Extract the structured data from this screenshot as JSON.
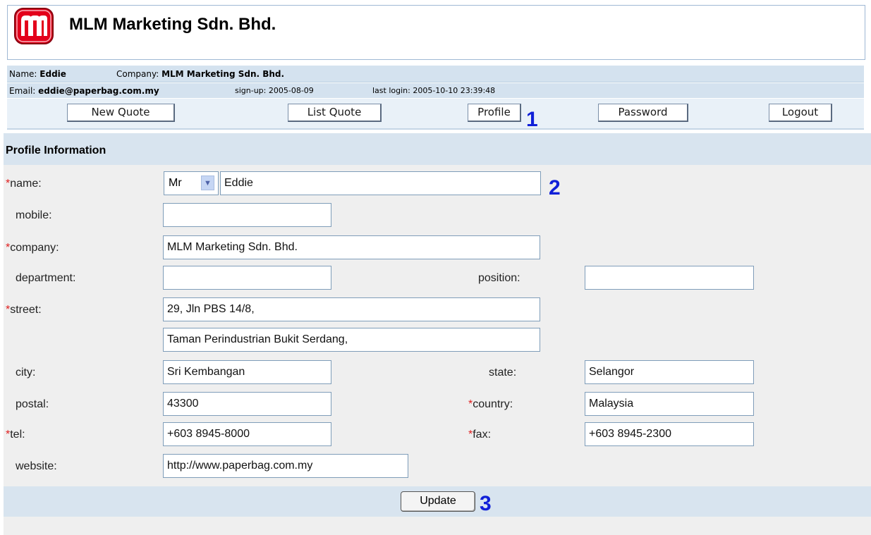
{
  "header": {
    "title": "MLM Marketing Sdn. Bhd."
  },
  "account": {
    "name_label": "Name:",
    "name": "Eddie",
    "company_label": "Company:",
    "company": "MLM Marketing Sdn. Bhd.",
    "email_label": "Email:",
    "email": "eddie@paperbag.com.my",
    "signup": "sign-up: 2005-08-09",
    "last_login": "last login: 2005-10-10 23:39:48"
  },
  "nav": {
    "new_quote": "New Quote",
    "list_quote": "List Quote",
    "profile": "Profile",
    "password": "Password",
    "logout": "Logout"
  },
  "markers": {
    "one": "1",
    "two": "2",
    "three": "3"
  },
  "section": {
    "title": "Profile Information"
  },
  "required_mark": "*",
  "form": {
    "labels": {
      "name": "name:",
      "mobile": "mobile:",
      "company": "company:",
      "department": "department:",
      "position": "position:",
      "street": "street:",
      "city": "city:",
      "state": "state:",
      "postal": "postal:",
      "country": "country:",
      "tel": "tel:",
      "fax": "fax:",
      "website": "website:"
    },
    "values": {
      "title": "Mr",
      "name": "Eddie",
      "mobile": "",
      "company": "MLM Marketing Sdn. Bhd.",
      "department": "",
      "position": "",
      "street1": "29, Jln PBS 14/8,",
      "street2": "Taman Perindustrian Bukit Serdang,",
      "city": "Sri Kembangan",
      "state": "Selangor",
      "postal": "43300",
      "country": "Malaysia",
      "tel": "+603 8945-8000",
      "fax": "+603 8945-2300",
      "website": "http://www.paperbag.com.my"
    },
    "update_label": "Update"
  },
  "colors": {
    "logo_red": "#e3001b",
    "marker_blue": "#1020d8",
    "required_red": "#e02020"
  },
  "icons": {
    "logo": "company-logo",
    "select_arrow": "chevron-down-icon"
  }
}
